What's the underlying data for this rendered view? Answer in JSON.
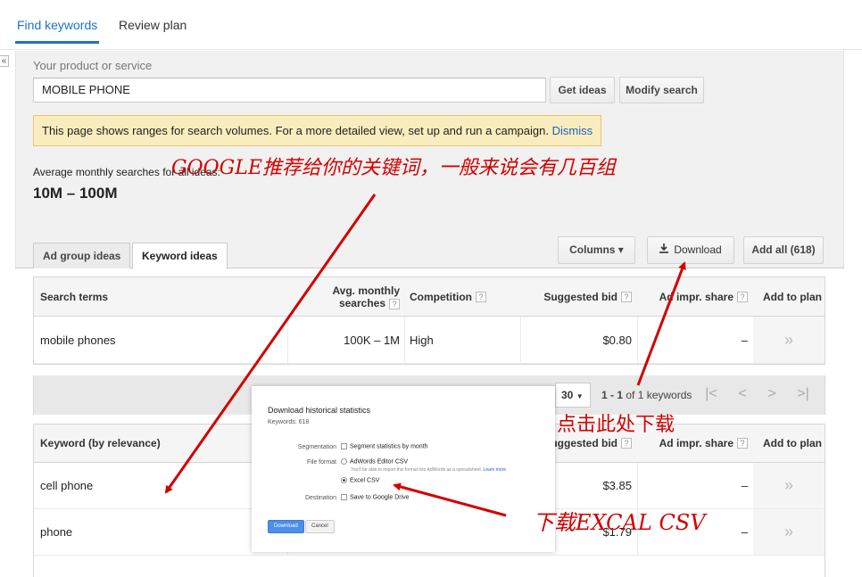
{
  "top_tabs": {
    "find_keywords": "Find keywords",
    "review_plan": "Review plan"
  },
  "collapse": "«",
  "search": {
    "label": "Your product or service",
    "value": "MOBILE PHONE",
    "get_ideas": "Get ideas",
    "modify_search": "Modify search"
  },
  "notice": {
    "text": "This page shows ranges for search volumes. For a more detailed view, set up and run a campaign.",
    "dismiss": "Dismiss"
  },
  "average": {
    "label": "Average monthly searches for all ideas:",
    "value": "10M – 100M"
  },
  "idea_tabs": {
    "ad_group": "Ad group ideas",
    "keyword": "Keyword ideas"
  },
  "toolbar": {
    "columns": "Columns ▾",
    "download": "Download",
    "add_all": "Add all (618)"
  },
  "search_terms_table": {
    "headers": {
      "term": "Search terms",
      "avg_line1": "Avg. monthly",
      "avg_line2": "searches",
      "competition": "Competition",
      "bid": "Suggested bid",
      "impr": "Ad impr. share",
      "add": "Add to plan"
    },
    "rows": [
      {
        "term": "mobile phones",
        "avg": "100K – 1M",
        "competition": "High",
        "bid": "$0.80",
        "impr": "–",
        "add": "»"
      }
    ]
  },
  "pager": {
    "per_page": "30",
    "range_prefix": "1 - 1",
    "range_suffix": "of 1 keywords"
  },
  "keyword_table": {
    "headers": {
      "keyword": "Keyword (by relevance)",
      "bid": "Suggested bid",
      "impr": "Ad impr. share",
      "add": "Add to plan"
    },
    "rows": [
      {
        "keyword": "cell phone",
        "bid": "$3.85",
        "impr": "–",
        "add": "»"
      },
      {
        "keyword": "phone",
        "bid": "$1.79",
        "impr": "–",
        "add": "»"
      }
    ]
  },
  "dialog": {
    "title": "Download historical statistics",
    "subtitle": "Keywords: 618",
    "segmentation_label": "Segmentation",
    "segmentation_option": "Segment statistics by month",
    "format_label": "File format",
    "format_adwords": "AdWords Editor CSV",
    "format_adwords_note": "You'll be able to import this format into AdWords as a spreadsheet.",
    "learn_more": "Learn more",
    "format_excel": "Excel CSV",
    "destination_label": "Destination",
    "destination_option": "Save to Google Drive",
    "download_btn": "Download",
    "cancel_btn": "Cancel"
  },
  "annotations": {
    "keywords_note": "GOOGLE推荐给你的关键词，一般来说会有几百组",
    "click_note": "点击此处下载",
    "excel_note": "下载EXCAL CSV"
  },
  "colors": {
    "link": "#1a73c8",
    "annotation": "#d40000",
    "notice_bg": "#f9edbe"
  }
}
